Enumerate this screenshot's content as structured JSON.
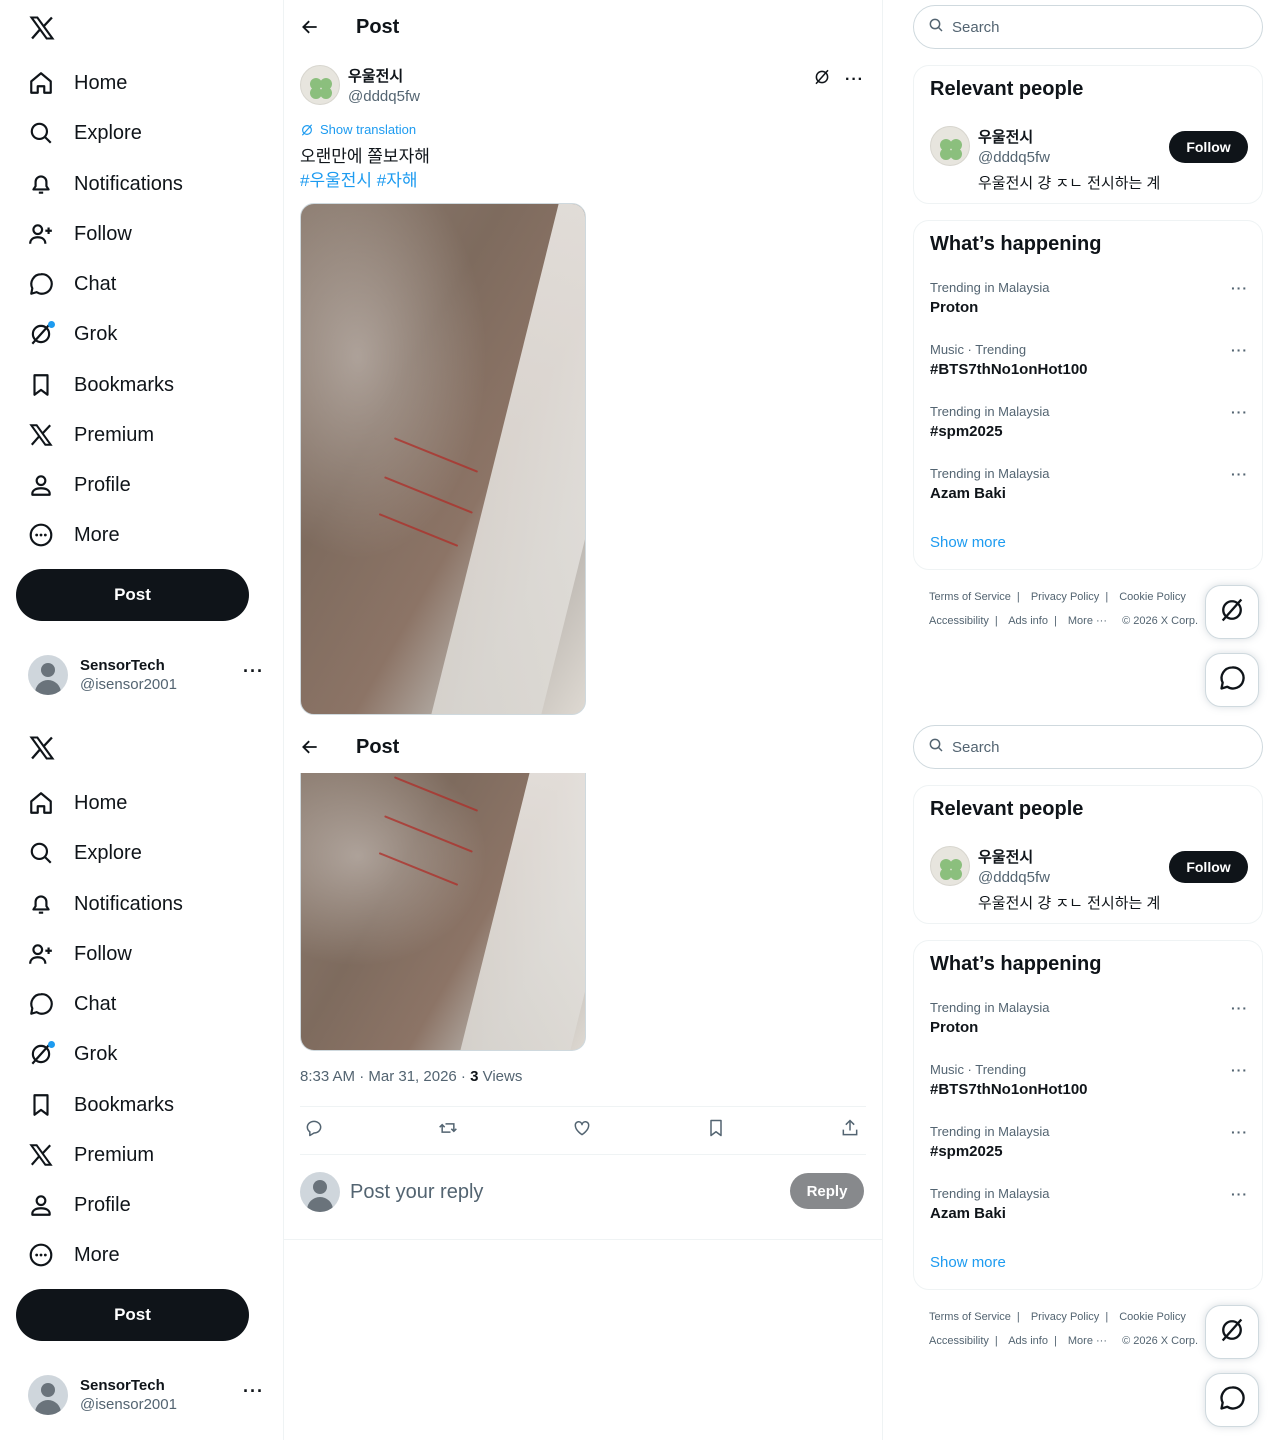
{
  "nav": {
    "items": [
      {
        "label": "Home",
        "icon": "home-icon"
      },
      {
        "label": "Explore",
        "icon": "search-icon"
      },
      {
        "label": "Notifications",
        "icon": "bell-icon"
      },
      {
        "label": "Follow",
        "icon": "add-user-icon"
      },
      {
        "label": "Chat",
        "icon": "chat-bubble-icon"
      },
      {
        "label": "Grok",
        "icon": "grok-icon"
      },
      {
        "label": "Bookmarks",
        "icon": "bookmark-icon"
      },
      {
        "label": "Premium",
        "icon": "x-logo-icon"
      },
      {
        "label": "Profile",
        "icon": "person-icon"
      },
      {
        "label": "More",
        "icon": "more-circle-icon"
      }
    ],
    "post_button": "Post",
    "account": {
      "name": "SensorTech",
      "handle": "@isensor2001",
      "more": "···"
    }
  },
  "main": {
    "header_title": "Post",
    "author": {
      "name": "우울전시",
      "handle": "@dddq5fw"
    },
    "more": "···",
    "show_translation": "Show translation",
    "text": "오랜만에 쫄보자해",
    "hashtags": "#우울전시 #자해",
    "timestamp": "8:33 AM · Mar 31, 2026 · ",
    "views_count": "3",
    "views_label": " Views",
    "reply_placeholder": "Post your reply",
    "reply_button": "Reply"
  },
  "right": {
    "search_placeholder": "Search",
    "relevant_people_title": "Relevant people",
    "person": {
      "name": "우울전시",
      "handle": "@dddq5fw",
      "bio": "우울전시 걍 ㅈㄴ 전시하는 계",
      "follow": "Follow"
    },
    "happening_title": "What’s happening",
    "trends": [
      {
        "context": "Trending in Malaysia",
        "name": "Proton"
      },
      {
        "context": "Music · Trending",
        "name": "#BTS7thNo1onHot100"
      },
      {
        "context": "Trending in Malaysia",
        "name": "#spm2025"
      },
      {
        "context": "Trending in Malaysia",
        "name": "Azam Baki"
      }
    ],
    "trend_more": "···",
    "show_more": "Show more",
    "footer": {
      "tos": "Terms of Service",
      "privacy": "Privacy Policy",
      "cookie": "Cookie Policy",
      "accessibility": "Accessibility",
      "ads": "Ads info",
      "more": "More ···",
      "copyright": "© 2026 X Corp."
    },
    "sep": "|"
  },
  "colors": {
    "accent": "#1d9bf0",
    "text": "#0f1419",
    "muted": "#536471",
    "border": "#eff3f4"
  }
}
